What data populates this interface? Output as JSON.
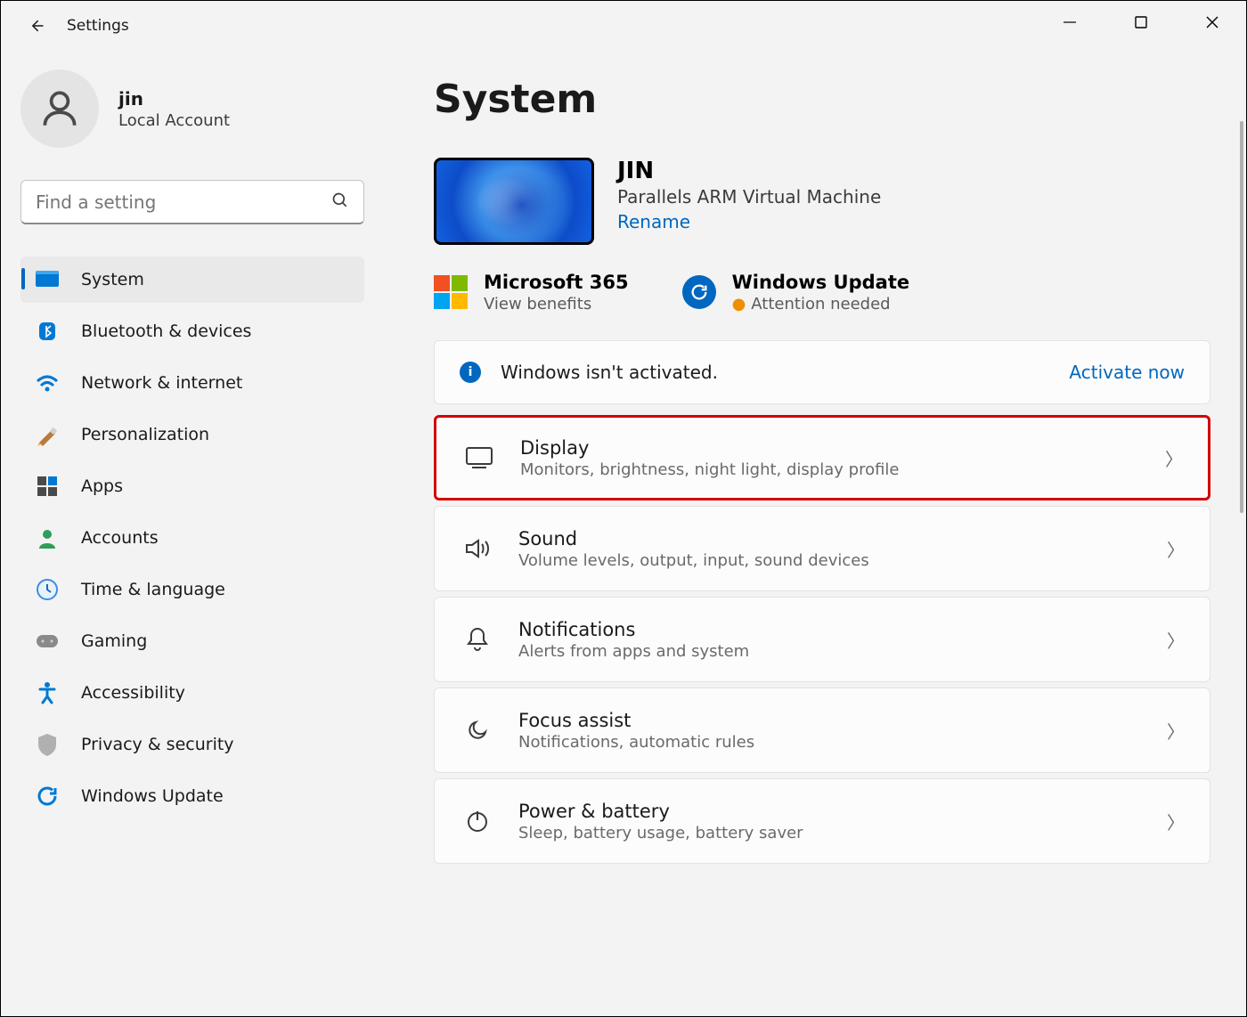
{
  "window": {
    "title": "Settings"
  },
  "user": {
    "name": "jin",
    "subtitle": "Local Account"
  },
  "search": {
    "placeholder": "Find a setting"
  },
  "nav": {
    "items": [
      {
        "label": "System",
        "selected": true,
        "icon": "system"
      },
      {
        "label": "Bluetooth & devices",
        "selected": false,
        "icon": "bluetooth"
      },
      {
        "label": "Network & internet",
        "selected": false,
        "icon": "network"
      },
      {
        "label": "Personalization",
        "selected": false,
        "icon": "personalization"
      },
      {
        "label": "Apps",
        "selected": false,
        "icon": "apps"
      },
      {
        "label": "Accounts",
        "selected": false,
        "icon": "accounts"
      },
      {
        "label": "Time & language",
        "selected": false,
        "icon": "time"
      },
      {
        "label": "Gaming",
        "selected": false,
        "icon": "gaming"
      },
      {
        "label": "Accessibility",
        "selected": false,
        "icon": "accessibility"
      },
      {
        "label": "Privacy & security",
        "selected": false,
        "icon": "privacy"
      },
      {
        "label": "Windows Update",
        "selected": false,
        "icon": "update"
      }
    ]
  },
  "main": {
    "heading": "System",
    "device": {
      "name": "JIN",
      "description": "Parallels ARM Virtual Machine",
      "rename_label": "Rename"
    },
    "services": {
      "m365": {
        "title": "Microsoft 365",
        "subtitle": "View benefits"
      },
      "wu": {
        "title": "Windows Update",
        "subtitle": "Attention needed"
      }
    },
    "banner": {
      "text": "Windows isn't activated.",
      "action": "Activate now"
    },
    "settings": [
      {
        "title": "Display",
        "subtitle": "Monitors, brightness, night light, display profile",
        "highlighted": true
      },
      {
        "title": "Sound",
        "subtitle": "Volume levels, output, input, sound devices",
        "highlighted": false
      },
      {
        "title": "Notifications",
        "subtitle": "Alerts from apps and system",
        "highlighted": false
      },
      {
        "title": "Focus assist",
        "subtitle": "Notifications, automatic rules",
        "highlighted": false
      },
      {
        "title": "Power & battery",
        "subtitle": "Sleep, battery usage, battery saver",
        "highlighted": false
      }
    ]
  }
}
